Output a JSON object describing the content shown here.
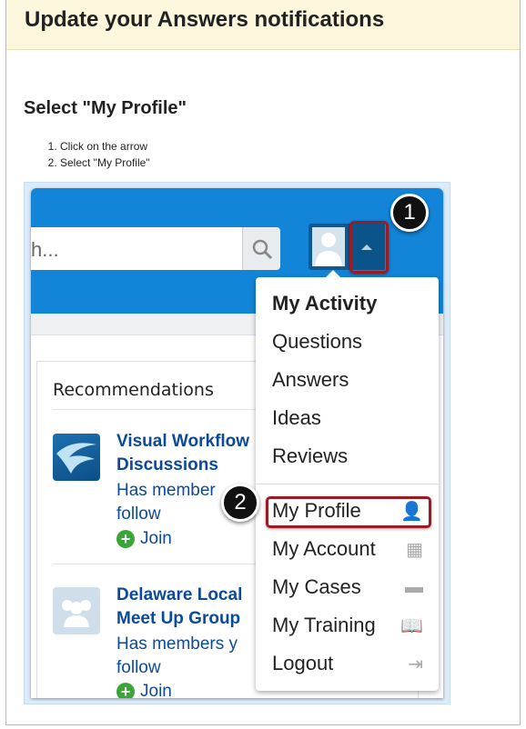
{
  "header": {
    "title": "Update your Answers notifications"
  },
  "step": {
    "title": "Select \"My Profile\"",
    "instructions": [
      "Click on the arrow",
      "Select \"My Profile\""
    ]
  },
  "app": {
    "search_placeholder": "h...",
    "accent": "#1385d8",
    "recommendations": {
      "title": "Recommendations",
      "groups": [
        {
          "name_line1": "Visual Workflow",
          "name_line2": "Discussions",
          "desc_line1": "Has member",
          "desc_line2": "follow",
          "join": "Join",
          "icon": "wave-logo-icon"
        },
        {
          "name_line1": "Delaware Local",
          "name_line2": "Meet Up Group",
          "desc_line1": "Has members y",
          "desc_line2": "follow",
          "join": "Join",
          "icon": "people-group-icon"
        }
      ]
    },
    "menu": {
      "heading": "My Activity",
      "activity_items": [
        "Questions",
        "Answers",
        "Ideas",
        "Reviews"
      ],
      "account_items": [
        {
          "label": "My Profile",
          "icon": "person-icon"
        },
        {
          "label": "My Account",
          "icon": "building-icon"
        },
        {
          "label": "My Cases",
          "icon": "briefcase-icon"
        },
        {
          "label": "My Training",
          "icon": "book-icon"
        },
        {
          "label": "Logout",
          "icon": "logout-arrow-icon"
        }
      ]
    }
  },
  "callouts": {
    "one": "1",
    "two": "2",
    "highlight_color": "#9b1b24"
  }
}
